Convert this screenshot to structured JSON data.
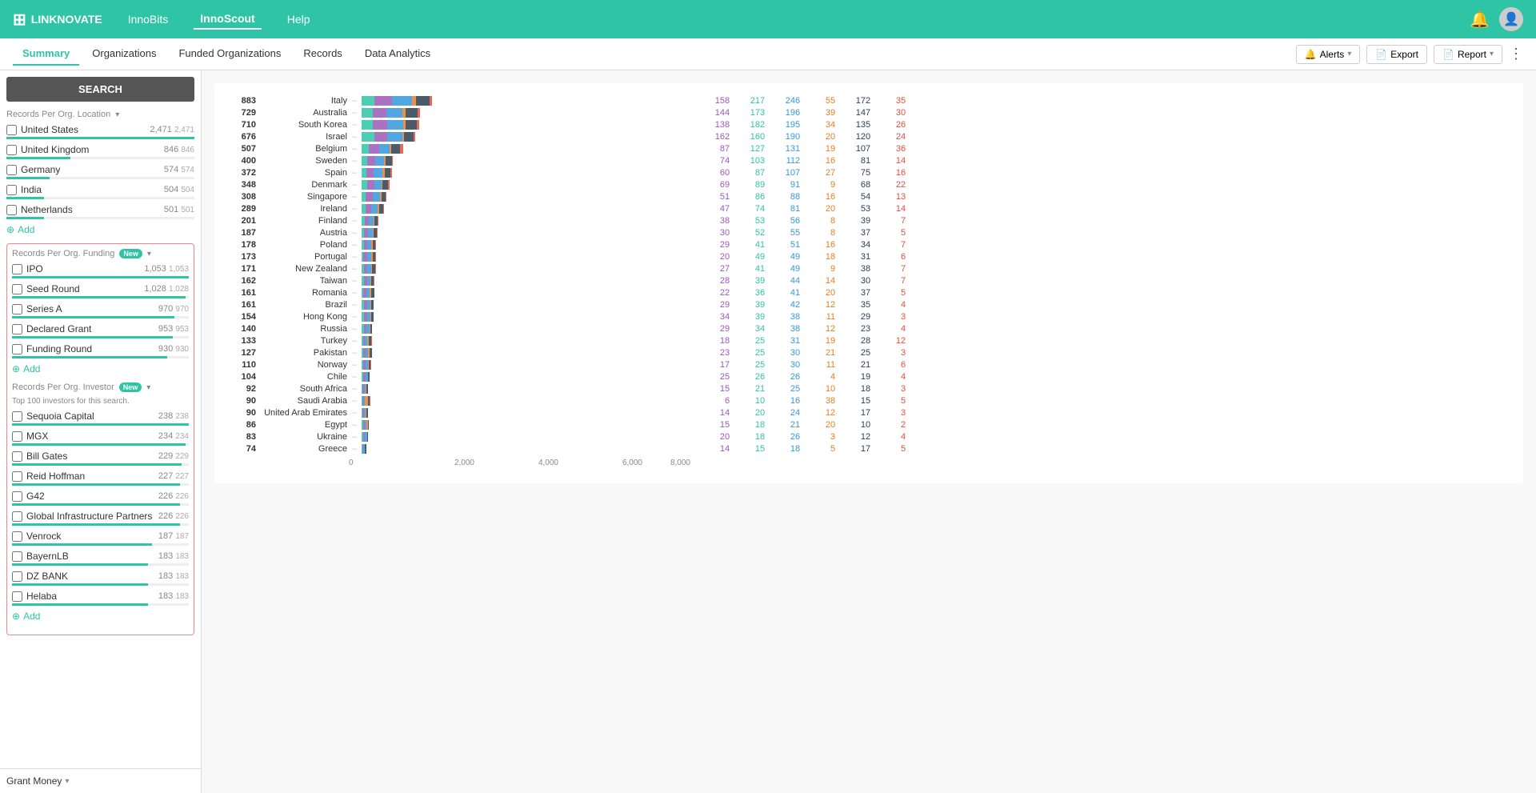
{
  "app": {
    "logo_text": "LINKNOVATE",
    "logo_icon": "⊞"
  },
  "top_nav": {
    "links": [
      {
        "label": "InnoBits",
        "active": false
      },
      {
        "label": "InnoScout",
        "active": true
      },
      {
        "label": "Help",
        "active": false
      }
    ]
  },
  "sub_nav": {
    "links": [
      {
        "label": "Summary",
        "active": true
      },
      {
        "label": "Organizations",
        "active": false
      },
      {
        "label": "Funded Organizations",
        "active": false
      },
      {
        "label": "Records",
        "active": false
      },
      {
        "label": "Data Analytics",
        "active": false
      }
    ],
    "alerts_label": "Alerts",
    "export_label": "Export",
    "report_label": "Report"
  },
  "sidebar": {
    "search_label": "SEARCH",
    "location_section": {
      "title": "Records Per Org. Location",
      "items": [
        {
          "label": "United States",
          "count": "2,471",
          "count2": "2,471",
          "bar_pct": 100
        },
        {
          "label": "United Kingdom",
          "count": "846",
          "count2": "846",
          "bar_pct": 34
        },
        {
          "label": "Germany",
          "count": "574",
          "count2": "574",
          "bar_pct": 23
        },
        {
          "label": "India",
          "count": "504",
          "count2": "504",
          "bar_pct": 20
        },
        {
          "label": "Netherlands",
          "count": "501",
          "count2": "501",
          "bar_pct": 20
        }
      ],
      "add_label": "Add"
    },
    "funding_section": {
      "title": "Records Per Org. Funding",
      "new_badge": "New",
      "items": [
        {
          "label": "IPO",
          "count": "1,053",
          "count2": "1,053",
          "bar_pct": 100
        },
        {
          "label": "Seed Round",
          "count": "1,028",
          "count2": "1,028",
          "bar_pct": 98
        },
        {
          "label": "Series A",
          "count": "970",
          "count2": "970",
          "bar_pct": 92
        },
        {
          "label": "Declared Grant",
          "count": "953",
          "count2": "953",
          "bar_pct": 90
        },
        {
          "label": "Funding Round",
          "count": "930",
          "count2": "930",
          "bar_pct": 88
        }
      ],
      "add_label": "Add"
    },
    "investor_section": {
      "title": "Records Per Org. Investor",
      "new_badge": "New",
      "subtitle": "Top 100 investors for this search.",
      "items": [
        {
          "label": "Sequoia Capital",
          "count": "238",
          "count2": "238",
          "bar_pct": 100
        },
        {
          "label": "MGX",
          "count": "234",
          "count2": "234",
          "bar_pct": 98
        },
        {
          "label": "Bill Gates",
          "count": "229",
          "count2": "229",
          "bar_pct": 96
        },
        {
          "label": "Reid Hoffman",
          "count": "227",
          "count2": "227",
          "bar_pct": 95
        },
        {
          "label": "G42",
          "count": "226",
          "count2": "226",
          "bar_pct": 95
        },
        {
          "label": "Global Infrastructure Partners",
          "count": "226",
          "count2": "226",
          "bar_pct": 95
        },
        {
          "label": "Venrock",
          "count": "187",
          "count2": "187",
          "bar_pct": 79
        },
        {
          "label": "BayernLB",
          "count": "183",
          "count2": "183",
          "bar_pct": 77
        },
        {
          "label": "DZ BANK",
          "count": "183",
          "count2": "183",
          "bar_pct": 77
        },
        {
          "label": "Helaba",
          "count": "183",
          "count2": "183",
          "bar_pct": 77
        }
      ],
      "add_label": "Add"
    },
    "grant_money_label": "Grant Money"
  },
  "chart": {
    "rows": [
      {
        "total": 883,
        "label": "Italy",
        "bar": 88,
        "s1": 158,
        "s2": 217,
        "s3": 246,
        "s4": 55,
        "s5": 172,
        "s6": 35
      },
      {
        "total": 729,
        "label": "Australia",
        "bar": 73,
        "s1": 144,
        "s2": 173,
        "s3": 196,
        "s4": 39,
        "s5": 147,
        "s6": 30
      },
      {
        "total": 710,
        "label": "South Korea",
        "bar": 71,
        "s1": 138,
        "s2": 182,
        "s3": 195,
        "s4": 34,
        "s5": 135,
        "s6": 26
      },
      {
        "total": 676,
        "label": "Israel",
        "bar": 68,
        "s1": 162,
        "s2": 160,
        "s3": 190,
        "s4": 20,
        "s5": 120,
        "s6": 24
      },
      {
        "total": 507,
        "label": "Belgium",
        "bar": 51,
        "s1": 87,
        "s2": 127,
        "s3": 131,
        "s4": 19,
        "s5": 107,
        "s6": 36
      },
      {
        "total": 400,
        "label": "Sweden",
        "bar": 40,
        "s1": 74,
        "s2": 103,
        "s3": 112,
        "s4": 16,
        "s5": 81,
        "s6": 14
      },
      {
        "total": 372,
        "label": "Spain",
        "bar": 37,
        "s1": 60,
        "s2": 87,
        "s3": 107,
        "s4": 27,
        "s5": 75,
        "s6": 16
      },
      {
        "total": 348,
        "label": "Denmark",
        "bar": 35,
        "s1": 69,
        "s2": 89,
        "s3": 91,
        "s4": 9,
        "s5": 68,
        "s6": 22
      },
      {
        "total": 308,
        "label": "Singapore",
        "bar": 31,
        "s1": 51,
        "s2": 86,
        "s3": 88,
        "s4": 16,
        "s5": 54,
        "s6": 13
      },
      {
        "total": 289,
        "label": "Ireland",
        "bar": 29,
        "s1": 47,
        "s2": 74,
        "s3": 81,
        "s4": 20,
        "s5": 53,
        "s6": 14
      },
      {
        "total": 201,
        "label": "Finland",
        "bar": 20,
        "s1": 38,
        "s2": 53,
        "s3": 56,
        "s4": 8,
        "s5": 39,
        "s6": 7
      },
      {
        "total": 187,
        "label": "Austria",
        "bar": 19,
        "s1": 30,
        "s2": 52,
        "s3": 55,
        "s4": 8,
        "s5": 37,
        "s6": 5
      },
      {
        "total": 178,
        "label": "Poland",
        "bar": 18,
        "s1": 29,
        "s2": 41,
        "s3": 51,
        "s4": 16,
        "s5": 34,
        "s6": 7
      },
      {
        "total": 173,
        "label": "Portugal",
        "bar": 17,
        "s1": 20,
        "s2": 49,
        "s3": 49,
        "s4": 18,
        "s5": 31,
        "s6": 6
      },
      {
        "total": 171,
        "label": "New Zealand",
        "bar": 17,
        "s1": 27,
        "s2": 41,
        "s3": 49,
        "s4": 9,
        "s5": 38,
        "s6": 7
      },
      {
        "total": 162,
        "label": "Taiwan",
        "bar": 16,
        "s1": 28,
        "s2": 39,
        "s3": 44,
        "s4": 14,
        "s5": 30,
        "s6": 7
      },
      {
        "total": 161,
        "label": "Romania",
        "bar": 16,
        "s1": 22,
        "s2": 36,
        "s3": 41,
        "s4": 20,
        "s5": 37,
        "s6": 5
      },
      {
        "total": 161,
        "label": "Brazil",
        "bar": 16,
        "s1": 29,
        "s2": 39,
        "s3": 42,
        "s4": 12,
        "s5": 35,
        "s6": 4
      },
      {
        "total": 154,
        "label": "Hong Kong",
        "bar": 15,
        "s1": 34,
        "s2": 39,
        "s3": 38,
        "s4": 11,
        "s5": 29,
        "s6": 3
      },
      {
        "total": 140,
        "label": "Russia",
        "bar": 14,
        "s1": 29,
        "s2": 34,
        "s3": 38,
        "s4": 12,
        "s5": 23,
        "s6": 4
      },
      {
        "total": 133,
        "label": "Turkey",
        "bar": 13,
        "s1": 18,
        "s2": 25,
        "s3": 31,
        "s4": 19,
        "s5": 28,
        "s6": 12
      },
      {
        "total": 127,
        "label": "Pakistan",
        "bar": 13,
        "s1": 23,
        "s2": 25,
        "s3": 30,
        "s4": 21,
        "s5": 25,
        "s6": 3
      },
      {
        "total": 110,
        "label": "Norway",
        "bar": 11,
        "s1": 17,
        "s2": 25,
        "s3": 30,
        "s4": 11,
        "s5": 21,
        "s6": 6
      },
      {
        "total": 104,
        "label": "Chile",
        "bar": 10,
        "s1": 25,
        "s2": 26,
        "s3": 26,
        "s4": 4,
        "s5": 19,
        "s6": 4
      },
      {
        "total": 92,
        "label": "South Africa",
        "bar": 9,
        "s1": 15,
        "s2": 21,
        "s3": 25,
        "s4": 10,
        "s5": 18,
        "s6": 3
      },
      {
        "total": 90,
        "label": "Saudi Arabia",
        "bar": 9,
        "s1": 6,
        "s2": 10,
        "s3": 16,
        "s4": 38,
        "s5": 15,
        "s6": 5
      },
      {
        "total": 90,
        "label": "United Arab Emirates",
        "bar": 9,
        "s1": 14,
        "s2": 20,
        "s3": 24,
        "s4": 12,
        "s5": 17,
        "s6": 3
      },
      {
        "total": 86,
        "label": "Egypt",
        "bar": 9,
        "s1": 15,
        "s2": 18,
        "s3": 21,
        "s4": 20,
        "s5": 10,
        "s6": 2
      },
      {
        "total": 83,
        "label": "Ukraine",
        "bar": 8,
        "s1": 20,
        "s2": 18,
        "s3": 26,
        "s4": 3,
        "s5": 12,
        "s6": 4
      },
      {
        "total": 74,
        "label": "Greece",
        "bar": 7,
        "s1": 14,
        "s2": 15,
        "s3": 18,
        "s4": 5,
        "s5": 17,
        "s6": 5
      }
    ],
    "x_axis": [
      "0",
      "2,000",
      "4,000",
      "6,000",
      "8,000"
    ]
  }
}
